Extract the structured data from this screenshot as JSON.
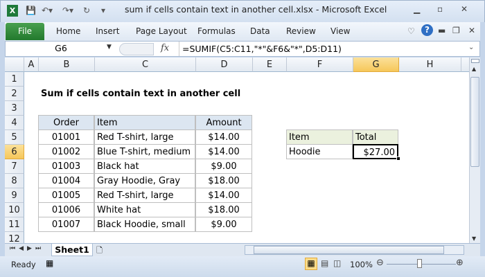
{
  "window": {
    "title": "sum if cells contain text in another cell.xlsx  -  Microsoft Excel"
  },
  "ribbon": {
    "file": "File",
    "tabs": [
      "Home",
      "Insert",
      "Page Layout",
      "Formulas",
      "Data",
      "Review",
      "View"
    ]
  },
  "formula_bar": {
    "name_box": "G6",
    "fx": "fx",
    "formula": "=SUMIF(C5:C11,\"*\"&F6&\"*\",D5:D11)"
  },
  "columns": [
    "A",
    "B",
    "C",
    "D",
    "E",
    "F",
    "G",
    "H"
  ],
  "rows": [
    "1",
    "2",
    "3",
    "4",
    "5",
    "6",
    "7",
    "8",
    "9",
    "10",
    "11",
    "12"
  ],
  "selected": {
    "column": "G",
    "row": "6"
  },
  "sheet": {
    "title": "Sum if cells contain text in another cell",
    "table_headers": [
      "Order",
      "Item",
      "Amount"
    ],
    "table_rows": [
      [
        "01001",
        "Red T-shirt, large",
        "$14.00"
      ],
      [
        "01002",
        "Blue T-shirt, medium",
        "$14.00"
      ],
      [
        "01003",
        "Black hat",
        "$9.00"
      ],
      [
        "01004",
        "Gray Hoodie, Gray",
        "$18.00"
      ],
      [
        "01005",
        "Red T-shirt, large",
        "$14.00"
      ],
      [
        "01006",
        "White hat",
        "$18.00"
      ],
      [
        "01007",
        "Black Hoodie, small",
        "$9.00"
      ]
    ],
    "lookup_headers": [
      "Item",
      "Total"
    ],
    "lookup_item": "Hoodie",
    "lookup_total": "$27.00"
  },
  "sheet_tabs": [
    "Sheet1"
  ],
  "status": {
    "ready": "Ready",
    "zoom": "100%"
  },
  "colors": {
    "table_header": "#dce6f1",
    "lookup_header": "#ebf1de",
    "file_green": "#2e8b3a"
  }
}
